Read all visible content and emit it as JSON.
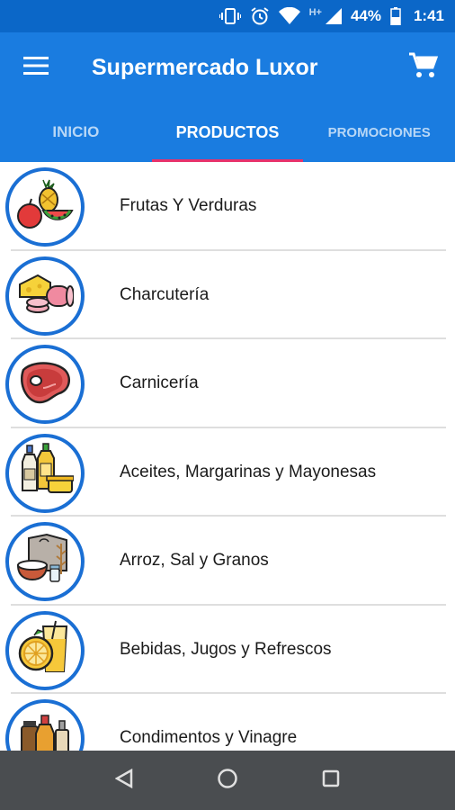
{
  "status_bar": {
    "network_label": "H+",
    "battery_level": "44%",
    "time": "1:41"
  },
  "app_bar": {
    "title": "Supermercado Luxor",
    "menu_icon": "hamburger-menu-icon",
    "cart_icon": "shopping-cart-icon"
  },
  "tabs": [
    {
      "label": "INICIO",
      "active": false
    },
    {
      "label": "PRODUCTOS",
      "active": true
    },
    {
      "label": "PROMOCIONES",
      "active": false
    }
  ],
  "categories": [
    {
      "label": "Frutas Y Verduras",
      "icon": "fruits-vegetables-icon"
    },
    {
      "label": "Charcutería",
      "icon": "deli-cheese-ham-icon"
    },
    {
      "label": "Carnicería",
      "icon": "meat-steak-icon"
    },
    {
      "label": "Aceites, Margarinas y Mayonesas",
      "icon": "oil-bottles-icon"
    },
    {
      "label": "Arroz, Sal y Granos",
      "icon": "rice-grains-icon"
    },
    {
      "label": "Bebidas, Jugos y Refrescos",
      "icon": "juice-drinks-icon"
    },
    {
      "label": "Condimentos y Vinagre",
      "icon": "condiments-bottles-icon"
    }
  ],
  "colors": {
    "status_bar": "#0b67c8",
    "app_bar": "#1a7ce0",
    "tab_indicator": "#e8326b",
    "icon_ring": "#1a6fd4",
    "nav_bar": "#4a4d50"
  },
  "nav_bar": {
    "back_icon": "back-triangle-icon",
    "home_icon": "home-circle-icon",
    "recents_icon": "recents-square-icon"
  }
}
